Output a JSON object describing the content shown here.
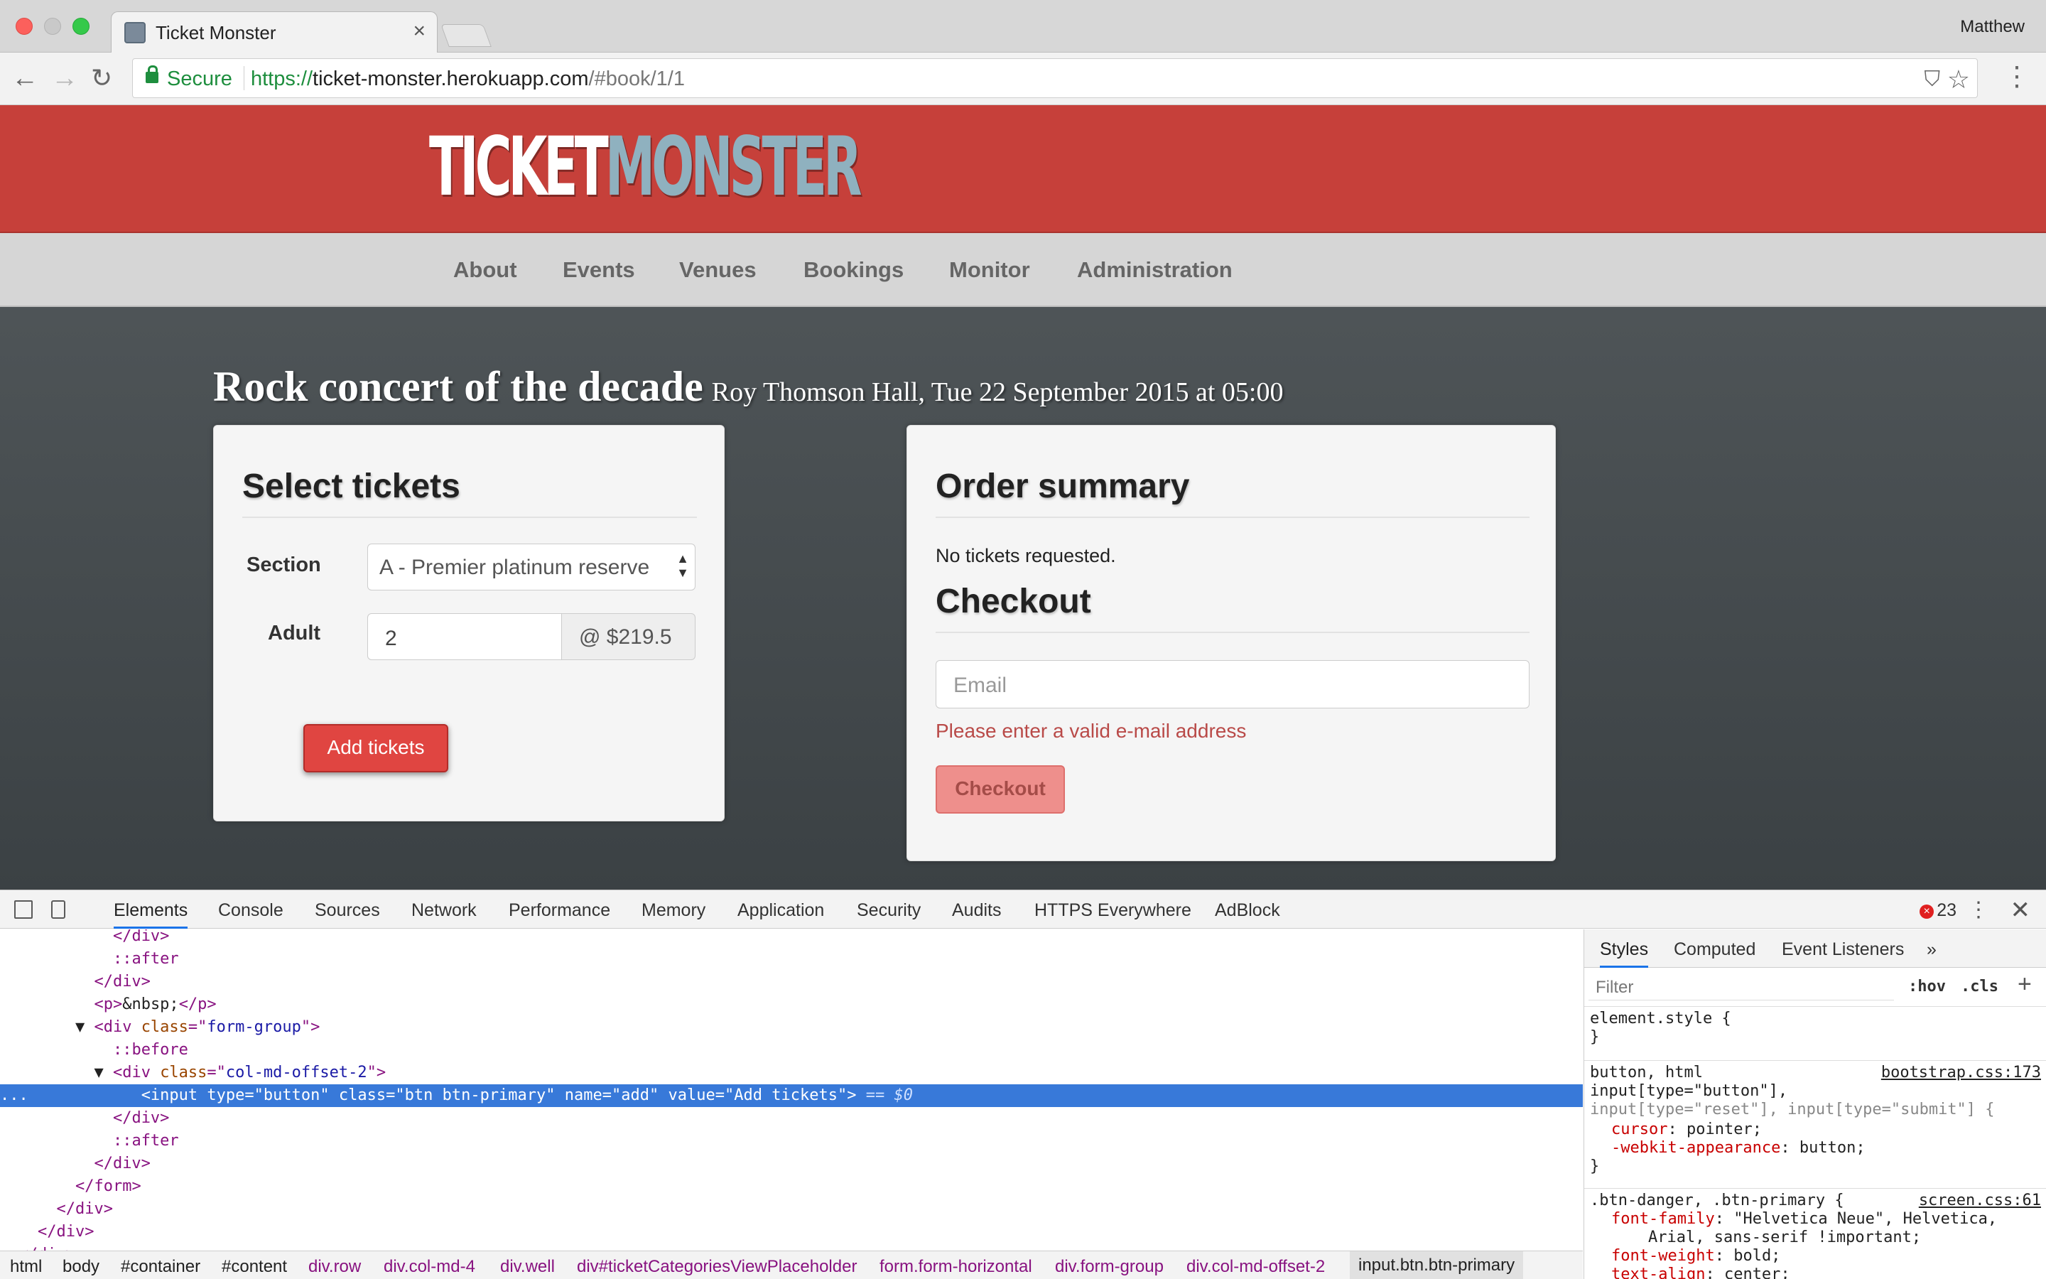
{
  "browser": {
    "tab_title": "Ticket Monster",
    "tab_close": "×",
    "profile_name": "Matthew",
    "secure_label": "Secure",
    "url_scheme": "https://",
    "url_host": "ticket-monster.herokuapp.com",
    "url_path": "/#book/1/1",
    "back_glyph": "←",
    "forward_glyph": "→",
    "reload_glyph": "↻",
    "star_glyph": "☆",
    "menu_glyph": "⋮",
    "shield_glyph": "⛉"
  },
  "site": {
    "logo_part1": "TICKET",
    "logo_part2": "MONSTER",
    "nav": [
      "About",
      "Events",
      "Venues",
      "Bookings",
      "Monitor",
      "Administration"
    ]
  },
  "event": {
    "name": "Rock concert of the decade",
    "details": "Roy Thomson Hall, Tue 22 September 2015 at 05:00"
  },
  "tickets": {
    "title": "Select tickets",
    "section_label": "Section",
    "section_value": "A - Premier platinum reserve",
    "select_arrows": "▲\n▼",
    "adult_label": "Adult",
    "adult_value": "2",
    "price": "@ $219.5",
    "add_button": "Add tickets"
  },
  "order": {
    "title": "Order summary",
    "empty_text": "No tickets requested.",
    "checkout_title": "Checkout",
    "email_placeholder": "Email",
    "email_error": "Please enter a valid e-mail address",
    "checkout_button": "Checkout"
  },
  "devtools": {
    "tabs": [
      "Elements",
      "Console",
      "Sources",
      "Network",
      "Performance",
      "Memory",
      "Application",
      "Security",
      "Audits",
      "HTTPS Everywhere",
      "AdBlock"
    ],
    "error_count": "23",
    "error_badge": "×",
    "kebab": "⋮",
    "close": "✕",
    "dom_lines": [
      {
        "indent": "            ",
        "parts": [
          [
            "tag",
            "</div>"
          ]
        ]
      },
      {
        "indent": "            ",
        "parts": [
          [
            "pseudo",
            "::after"
          ]
        ]
      },
      {
        "indent": "          ",
        "parts": [
          [
            "tag",
            "</div>"
          ]
        ]
      },
      {
        "indent": "          ",
        "parts": [
          [
            "tag",
            "<p>"
          ],
          [
            "plain",
            "&nbsp;"
          ],
          [
            "tag",
            "</p>"
          ]
        ]
      },
      {
        "indent": "        ▼ ",
        "parts": [
          [
            "tag",
            "<div "
          ],
          [
            "attr",
            "class"
          ],
          [
            "tag",
            "=\""
          ],
          [
            "val",
            "form-group"
          ],
          [
            "tag",
            "\">"
          ]
        ]
      },
      {
        "indent": "            ",
        "parts": [
          [
            "pseudo",
            "::before"
          ]
        ]
      },
      {
        "indent": "          ▼ ",
        "parts": [
          [
            "tag",
            "<div "
          ],
          [
            "attr",
            "class"
          ],
          [
            "tag",
            "=\""
          ],
          [
            "val",
            "col-md-offset-2"
          ],
          [
            "tag",
            "\">"
          ]
        ]
      },
      {
        "indent": "...            ",
        "selected": true,
        "parts": [
          [
            "tag",
            "<input "
          ],
          [
            "attr",
            "type"
          ],
          [
            "tag",
            "=\""
          ],
          [
            "val",
            "button"
          ],
          [
            "tag",
            "\" "
          ],
          [
            "attr",
            "class"
          ],
          [
            "tag",
            "=\""
          ],
          [
            "val",
            "btn btn-primary"
          ],
          [
            "tag",
            "\" "
          ],
          [
            "attr",
            "name"
          ],
          [
            "tag",
            "=\""
          ],
          [
            "val",
            "add"
          ],
          [
            "tag",
            "\" "
          ],
          [
            "attr",
            "value"
          ],
          [
            "tag",
            "=\""
          ],
          [
            "val",
            "Add tickets"
          ],
          [
            "tag",
            "\">"
          ],
          [
            "eq",
            " == $0"
          ]
        ]
      },
      {
        "indent": "            ",
        "parts": [
          [
            "tag",
            "</div>"
          ]
        ]
      },
      {
        "indent": "            ",
        "parts": [
          [
            "pseudo",
            "::after"
          ]
        ]
      },
      {
        "indent": "          ",
        "parts": [
          [
            "tag",
            "</div>"
          ]
        ]
      },
      {
        "indent": "        ",
        "parts": [
          [
            "tag",
            "</form>"
          ]
        ]
      },
      {
        "indent": "      ",
        "parts": [
          [
            "tag",
            "</div>"
          ]
        ]
      },
      {
        "indent": "    ",
        "parts": [
          [
            "tag",
            "</div>"
          ]
        ]
      },
      {
        "indent": "  ",
        "parts": [
          [
            "tag",
            "</div>"
          ]
        ]
      }
    ],
    "breadcrumbs": [
      "html",
      "body",
      "#container",
      "#content",
      "div.row",
      "div.col-md-4",
      "div.well",
      "div#ticketCategoriesViewPlaceholder",
      "form.form-horizontal",
      "div.form-group",
      "div.col-md-offset-2",
      "input.btn.btn-primary"
    ],
    "styles_tabs": [
      "Styles",
      "Computed",
      "Event Listeners",
      "»"
    ],
    "filter_placeholder": "Filter",
    "hov": ":hov",
    "cls": ".cls",
    "plus": "+",
    "rule1": {
      "selector": "element.style {",
      "close": "}"
    },
    "rule2": {
      "selector_line1": "button, html",
      "selector_line2": "input[type=\"button\"],",
      "selector_line3": "input[type=\"reset\"], input[type=\"submit\"] {",
      "source": "bootstrap.css:173",
      "prop1": "cursor",
      "val1": "pointer;",
      "prop2": "-webkit-appearance",
      "val2": "button;",
      "close": "}"
    },
    "rule3": {
      "selector": ".btn-danger, .btn-primary {",
      "source": "screen.css:61",
      "prop1": "font-family",
      "val1": "\"Helvetica Neue\", Helvetica,",
      "val1b": "Arial, sans-serif !important;",
      "prop2": "font-weight",
      "val2": "bold;",
      "prop3": "text-align",
      "val3": "center;"
    }
  }
}
